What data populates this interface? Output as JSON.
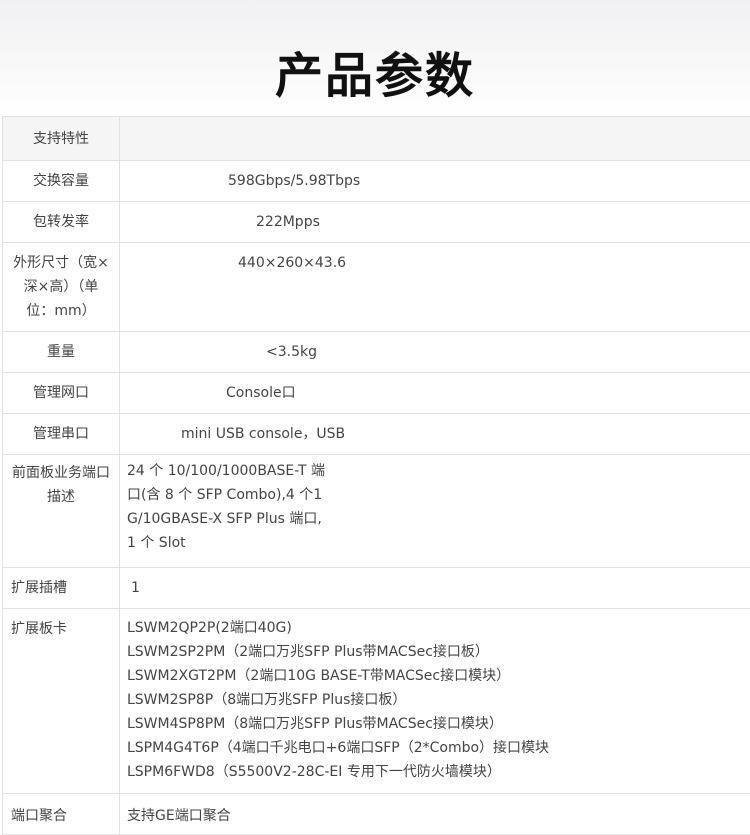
{
  "page": {
    "title": "产品参数"
  },
  "spec": {
    "header": "支持特性",
    "rows": [
      {
        "key": "交换容量",
        "value": "598Gbps/5.98Tbps"
      },
      {
        "key": "包转发率",
        "value": "222Mpps"
      },
      {
        "key": "外形尺寸（宽×深×高）（单位：mm）",
        "value": "440×260×43.6"
      },
      {
        "key": "重量",
        "value": "<3.5kg"
      },
      {
        "key": "管理网口",
        "value": "Console口"
      },
      {
        "key": "管理串口",
        "value": "mini USB console，USB"
      },
      {
        "key": "前面板业务端口描述",
        "value": "24 个 10/100/1000BASE-T 端口(含 8 个 SFP Combo),4 个1G/10GBASE-X SFP Plus 端口,1 个 Slot"
      },
      {
        "key": "扩展插槽",
        "value": "1"
      },
      {
        "key": "扩展板卡",
        "lines": [
          "LSWM2QP2P(2端口40G)",
          "LSWM2SP2PM（2端口万兆SFP Plus带MACSec接口板）",
          "LSWM2XGT2PM（2端口10G BASE-T带MACSec接口模块）",
          "LSWM2SP8P（8端口万兆SFP Plus接口板）",
          "LSWM4SP8PM（8端口万兆SFP Plus带MACSec接口模块）",
          "LSPM4G4T6P（4端口千兆电口+6端口SFP（2*Combo）接口模块",
          "LSPM6FWD8（S5500V2-28C-EI 专用下一代防火墙模块）"
        ]
      },
      {
        "key": "端口聚合",
        "value": "支持GE端口聚合"
      }
    ]
  }
}
